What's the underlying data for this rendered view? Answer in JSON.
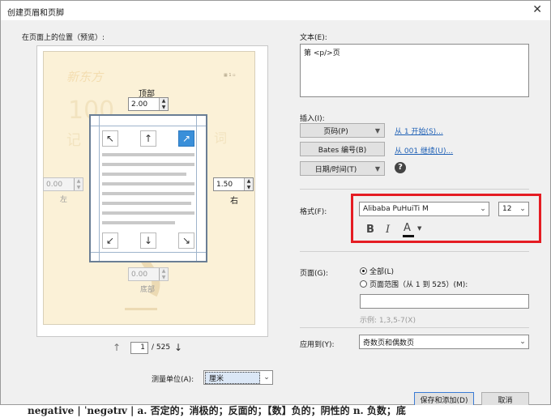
{
  "window": {
    "title": "创建页眉和页脚",
    "close_icon": "close-icon"
  },
  "preview": {
    "heading": "在页面上的位置（预览）:",
    "top_label": "顶部",
    "top_value": "2.00",
    "left_label": "左",
    "left_value": "0.00",
    "right_label": "右",
    "right_value": "1.50",
    "bottom_label": "底部",
    "bottom_value": "0.00",
    "page_current": "1",
    "page_total": "/ 525",
    "page_bg_colors": {
      "page": "#fbf1d7",
      "active_button": "#3a8fd9"
    }
  },
  "units": {
    "label": "测量单位(A):",
    "value": "厘米"
  },
  "text_section": {
    "label": "文本(E):",
    "value": "第 <p/>页"
  },
  "insert": {
    "label": "插入(I):",
    "page_number_button": "页码(P)",
    "page_number_link": "从 1 开始(S)...",
    "bates_button": "Bates 编号(B)",
    "bates_link": "从 001 继续(U)...",
    "datetime_button": "日期/时间(T)",
    "help_icon": "help-icon"
  },
  "format": {
    "label": "格式(F):",
    "font": "Alibaba PuHuiTi M",
    "size": "12",
    "bold": "B",
    "italic": "I",
    "color": "A",
    "highlight_color": "#e51c23"
  },
  "pages": {
    "label": "页面(G):",
    "all_label": "全部(L)",
    "range_label": "页面范围（从 1 到 525）(M):",
    "range_value": "",
    "example": "示例: 1,3,5-7(X)"
  },
  "apply_to": {
    "label": "应用到(Y):",
    "value": "奇数页和偶数页"
  },
  "buttons": {
    "save_add": "保存和添加(D)",
    "cancel": "取消"
  },
  "background_text": "negative | ˈneɡətɪv | a. 否定的；消极的；反面的；【数】负的；阴性的 n. 负数；底"
}
